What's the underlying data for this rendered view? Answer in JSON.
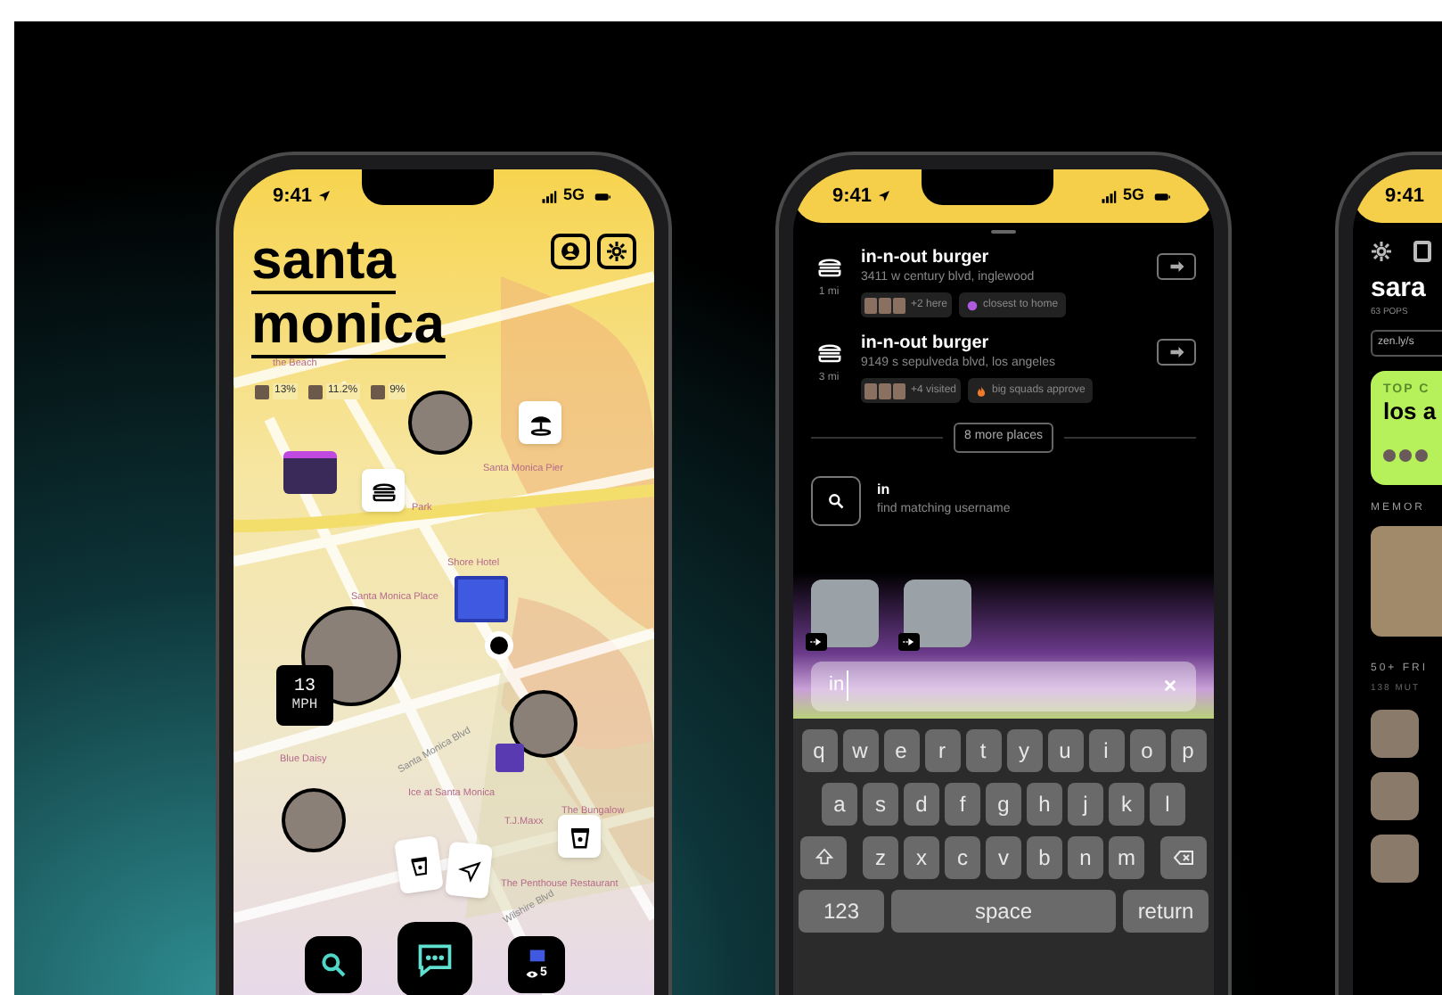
{
  "map_phone": {
    "status": {
      "time": "9:41",
      "network": "5G"
    },
    "title": [
      "santa",
      "monica"
    ],
    "stats": [
      {
        "value": "13%"
      },
      {
        "value": "11.2%"
      },
      {
        "value": "9%"
      }
    ],
    "map_labels": [
      {
        "text": "the Beach"
      },
      {
        "text": "Santa Monica Pier"
      },
      {
        "text": "Park"
      },
      {
        "text": "Shore Hotel"
      },
      {
        "text": "Santa Monica Place"
      },
      {
        "text": "Blue Daisy"
      },
      {
        "text": "Santa Monica Blvd"
      },
      {
        "text": "Ice at Santa Monica"
      },
      {
        "text": "T.J.Maxx"
      },
      {
        "text": "The Bungalow"
      },
      {
        "text": "The Penthouse Restaurant"
      },
      {
        "text": "Wilshire Blvd"
      }
    ],
    "speed": {
      "value": "13",
      "unit": "MPH"
    },
    "dock_count": "5"
  },
  "search_phone": {
    "status": {
      "time": "9:41",
      "network": "5G"
    },
    "places": [
      {
        "name": "in-n-out burger",
        "address": "3411 w century blvd, inglewood",
        "distance": "1 mi",
        "friends": "+2 here",
        "tag": "closest to home",
        "kind": "home"
      },
      {
        "name": "in-n-out burger",
        "address": "9149 s sepulveda blvd, los angeles",
        "distance": "3 mi",
        "friends": "+4 visited",
        "tag": "big squads approve",
        "kind": "fire"
      }
    ],
    "more_places": "8 more places",
    "suggestion": {
      "query": "in",
      "hint": "find matching username"
    },
    "search_value": "in",
    "keyboard": [
      [
        "q",
        "w",
        "e",
        "r",
        "t",
        "y",
        "u",
        "i",
        "o",
        "p"
      ],
      [
        "a",
        "s",
        "d",
        "f",
        "g",
        "h",
        "j",
        "k",
        "l"
      ],
      [
        "z",
        "x",
        "c",
        "v",
        "b",
        "n",
        "m"
      ]
    ],
    "bottom_keys": [
      "123",
      "space",
      "return"
    ]
  },
  "profile_phone": {
    "time": "9:41",
    "name": "sara",
    "pops": "63 POPS",
    "link": "zen.ly/s",
    "card_kicker": "TOP C",
    "card_title": "los a",
    "memories": "MEMOR",
    "friends": "50+ FRI",
    "mutuals": "138 MUT"
  }
}
